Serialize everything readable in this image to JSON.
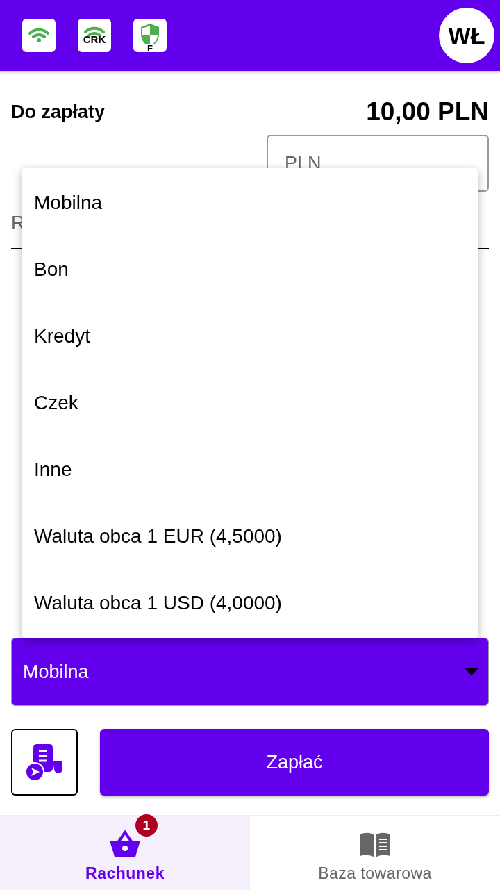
{
  "header": {
    "status_icons": [
      {
        "kind": "wifi"
      },
      {
        "kind": "crk",
        "label": "CRK"
      },
      {
        "kind": "shield",
        "label": "F"
      }
    ],
    "avatar": "WŁ"
  },
  "summary": {
    "label": "Do zapłaty",
    "amount": "10,00 PLN"
  },
  "payment_amount": {
    "currency": "PLN"
  },
  "row_2_label": "R",
  "payment_method": {
    "value": "Mobilna",
    "expanded": true
  },
  "menu": {
    "items": [
      "Mobilna",
      "Bon",
      "Kredyt",
      "Czek",
      "Inne",
      "Waluta obca 1 EUR (4,5000)",
      "Waluta obca 1 USD (4,0000)"
    ]
  },
  "pay_button": "Zapłać",
  "nav": [
    {
      "label": "Rachunek",
      "kind": "basket",
      "badge": "1",
      "selected": true
    },
    {
      "label": "Baza towarowa",
      "kind": "book",
      "selected": false
    }
  ]
}
